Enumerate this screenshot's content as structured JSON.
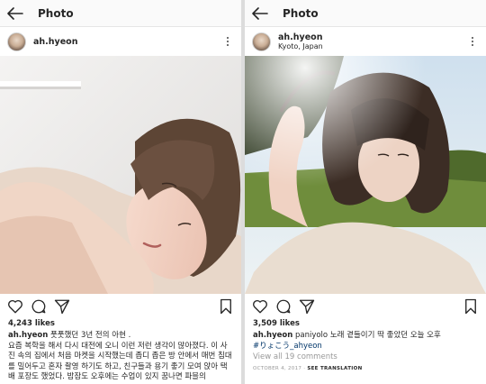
{
  "panels": [
    {
      "topbar": {
        "title": "Photo"
      },
      "post": {
        "username": "ah.hyeon",
        "location": "",
        "likes": "4,243 likes",
        "caption_user": "ah.hyeon",
        "caption_text": "풋풋했던 3년 전의 아현 .",
        "body_text": "요즘 복학을 해서 다시 대전에 오니 이런 저런 생각이 많아졌다. 이 사진 속의 집에서 처음 마켓을 시작했는데 좁디 좁은 방 안에서 매번 침대를 밀어두고 혼자 촬영 하기도 하고, 친구들과 용기 좋기 모여 앉아 택배 포장도 했었다. 밤잠도 오후에는 수업이 있지 꿈나면 파블의"
      }
    },
    {
      "topbar": {
        "title": "Photo"
      },
      "post": {
        "username": "ah.hyeon",
        "location": "Kyoto, Japan",
        "likes": "3,509 likes",
        "caption_user": "ah.hyeon",
        "caption_text": "paniyolo 노래 곁들이기 딱 좋았던 오늘 오후",
        "hashtag": "#りょこう_ahyeon",
        "view_all": "View all 19 comments",
        "date": "OCTOBER 4, 2017",
        "separator": "·",
        "translation": "SEE TRANSLATION"
      }
    }
  ],
  "icons": [
    "back-arrow-icon",
    "more-options-icon",
    "heart-icon",
    "comment-icon",
    "share-icon",
    "bookmark-icon"
  ]
}
